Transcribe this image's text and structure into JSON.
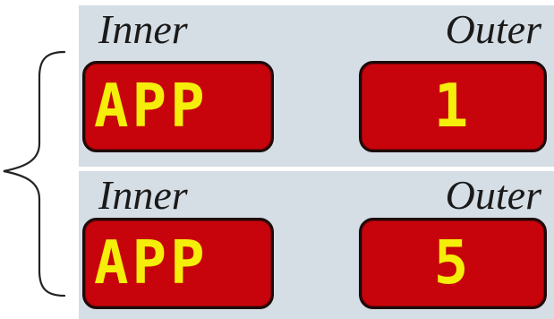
{
  "colors": {
    "panel_background": "#d5dde5",
    "display_background": "#c7040b",
    "display_border": "#1e0a0a",
    "readout_text": "#f4ee0a",
    "label_text": "#1a1a1a",
    "brace": "#222222"
  },
  "groups": [
    {
      "inner_label": "Inner",
      "outer_label": "Outer",
      "inner_value": "APP",
      "outer_value": "1"
    },
    {
      "inner_label": "Inner",
      "outer_label": "Outer",
      "inner_value": "APP",
      "outer_value": "5"
    }
  ],
  "icons": {
    "brace": "curly-brace-icon"
  }
}
